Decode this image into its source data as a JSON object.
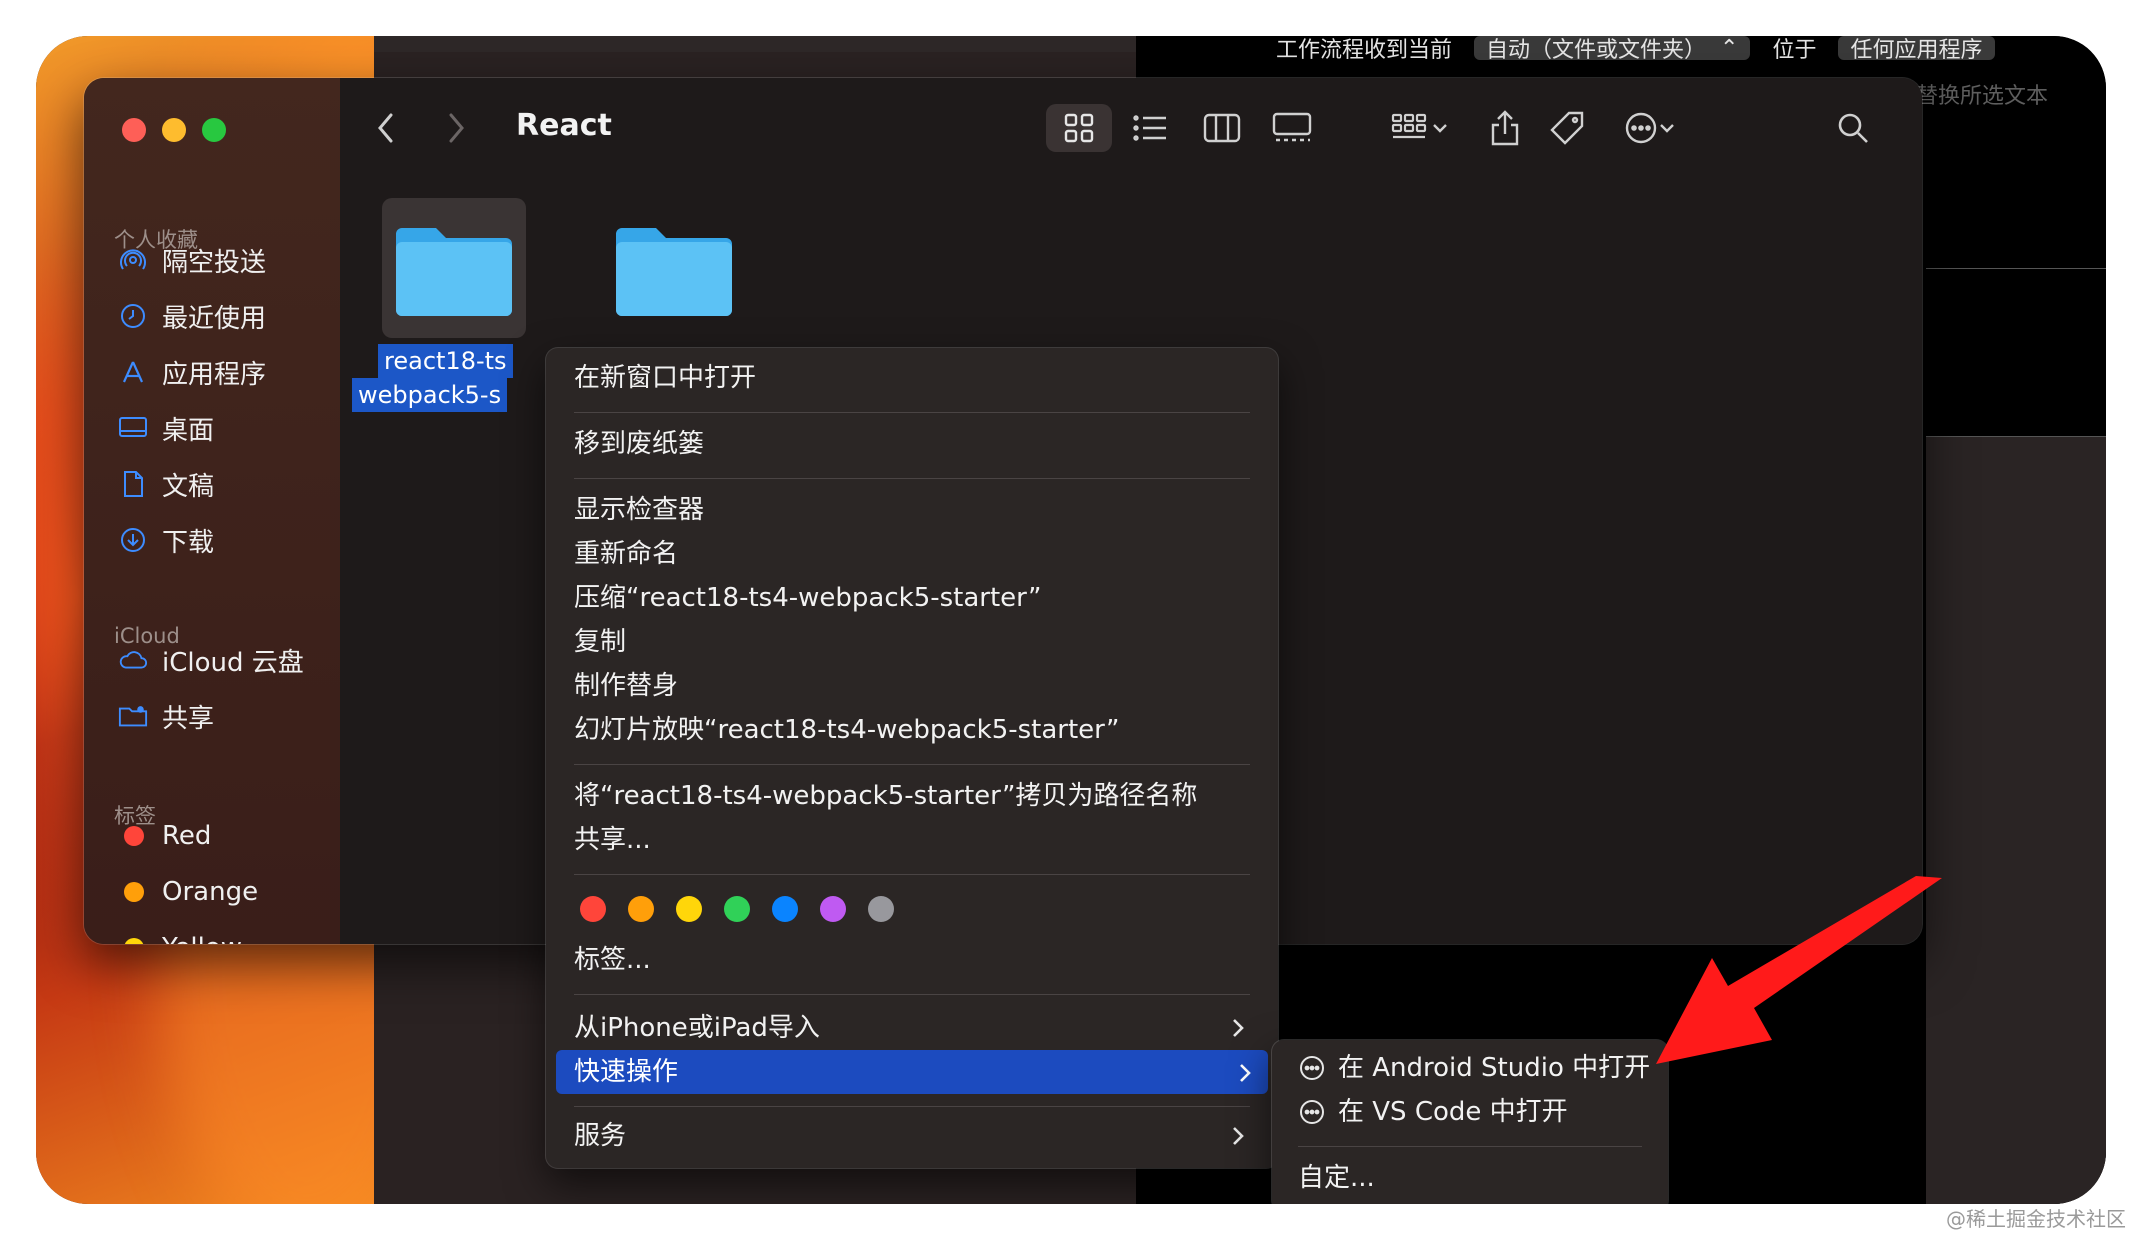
{
  "top_bar": {
    "workflow_label": "工作流程收到当前",
    "input_type": "自动（文件或文件夹）",
    "location_label": "位于",
    "app_selector": "任何应用程序",
    "replace_placeholder": "替换所选文本"
  },
  "finder": {
    "title": "React",
    "sidebar": {
      "favorites_header": "个人收藏",
      "favorites": [
        {
          "label": "隔空投送",
          "icon": "airdrop-icon"
        },
        {
          "label": "最近使用",
          "icon": "clock-icon"
        },
        {
          "label": "应用程序",
          "icon": "applications-icon"
        },
        {
          "label": "桌面",
          "icon": "desktop-icon"
        },
        {
          "label": "文稿",
          "icon": "document-icon"
        },
        {
          "label": "下载",
          "icon": "download-icon"
        }
      ],
      "icloud_header": "iCloud",
      "icloud": [
        {
          "label": "iCloud 云盘",
          "icon": "cloud-icon"
        },
        {
          "label": "共享",
          "icon": "shared-folder-icon"
        }
      ],
      "tags_header": "标签",
      "tags": [
        {
          "label": "Red",
          "color": "#ff453a"
        },
        {
          "label": "Orange",
          "color": "#ff9f0a"
        },
        {
          "label": "Yellow",
          "color": "#ffd60a"
        }
      ]
    },
    "files": [
      {
        "label_line1": "react18-ts",
        "label_line2": "webpack5-s",
        "selected": true
      },
      {
        "label_line1": "",
        "label_line2": "",
        "selected": false
      }
    ]
  },
  "context_menu": {
    "items": {
      "open_new_window": "在新窗口中打开",
      "move_to_trash": "移到废纸篓",
      "show_inspector": "显示检查器",
      "rename": "重新命名",
      "compress": "压缩“react18-ts4-webpack5-starter”",
      "duplicate": "复制",
      "make_alias": "制作替身",
      "slideshow": "幻灯片放映“react18-ts4-webpack5-starter”",
      "copy_path": "将“react18-ts4-webpack5-starter”拷贝为路径名称",
      "share": "共享...",
      "tags": "标签...",
      "import_iphone": "从iPhone或iPad导入",
      "quick_actions": "快速操作",
      "services": "服务"
    },
    "tag_colors": [
      "#ff453a",
      "#ff9f0a",
      "#ffd60a",
      "#30d158",
      "#0a84ff",
      "#bf5af2",
      "#98989d"
    ]
  },
  "submenu": {
    "open_android_studio": "在 Android Studio 中打开",
    "open_vscode": "在 VS Code 中打开",
    "customize": "自定..."
  },
  "accent_color": "#1c4bbf",
  "annotation_arrow_color": "#ff1a1a",
  "watermark": "@稀土掘金技术社区"
}
